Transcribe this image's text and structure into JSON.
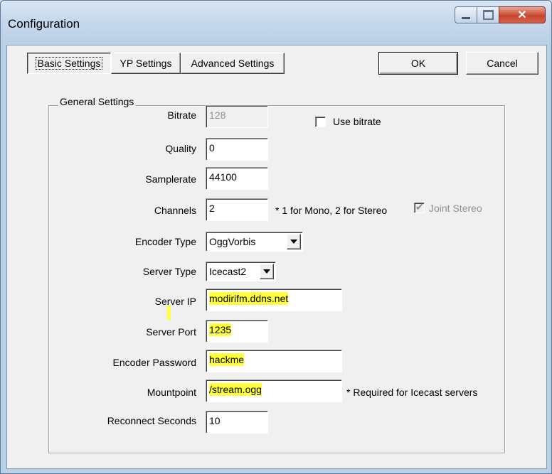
{
  "window": {
    "title": "Configuration"
  },
  "tabs": {
    "basic": "Basic Settings",
    "yp": "YP Settings",
    "advanced": "Advanced Settings"
  },
  "buttons": {
    "ok": "OK",
    "cancel": "Cancel"
  },
  "group": {
    "label": "General Settings"
  },
  "fields": {
    "bitrate": {
      "label": "Bitrate",
      "value": "128"
    },
    "use_bitrate": {
      "label": "Use bitrate",
      "checked": false
    },
    "quality": {
      "label": "Quality",
      "value": "0"
    },
    "samplerate": {
      "label": "Samplerate",
      "value": "44100"
    },
    "channels": {
      "label": "Channels",
      "value": "2",
      "note": "* 1 for Mono, 2 for Stereo"
    },
    "joint_stereo": {
      "label": "Joint Stereo",
      "checked": true
    },
    "encoder_type": {
      "label": "Encoder Type",
      "value": "OggVorbis"
    },
    "server_type": {
      "label": "Server Type",
      "value": "Icecast2"
    },
    "server_ip": {
      "label": "Server IP",
      "value": "modirifm.ddns.net"
    },
    "server_port": {
      "label": "Server Port",
      "value": "1235"
    },
    "encoder_password": {
      "label": "Encoder Password",
      "value": "hackme"
    },
    "mountpoint": {
      "label": "Mountpoint",
      "value": "/stream.ogg",
      "note": "* Required for Icecast servers"
    },
    "reconnect": {
      "label": "Reconnect Seconds",
      "value": "10"
    }
  },
  "colors": {
    "highlight": "#ffff3b",
    "close_button": "#c8452c"
  },
  "icons": {
    "minimize": "minimize-icon",
    "maximize": "maximize-icon",
    "close": "close-icon",
    "checkmark": "checkmark-icon",
    "dropdown": "chevron-down-icon"
  }
}
